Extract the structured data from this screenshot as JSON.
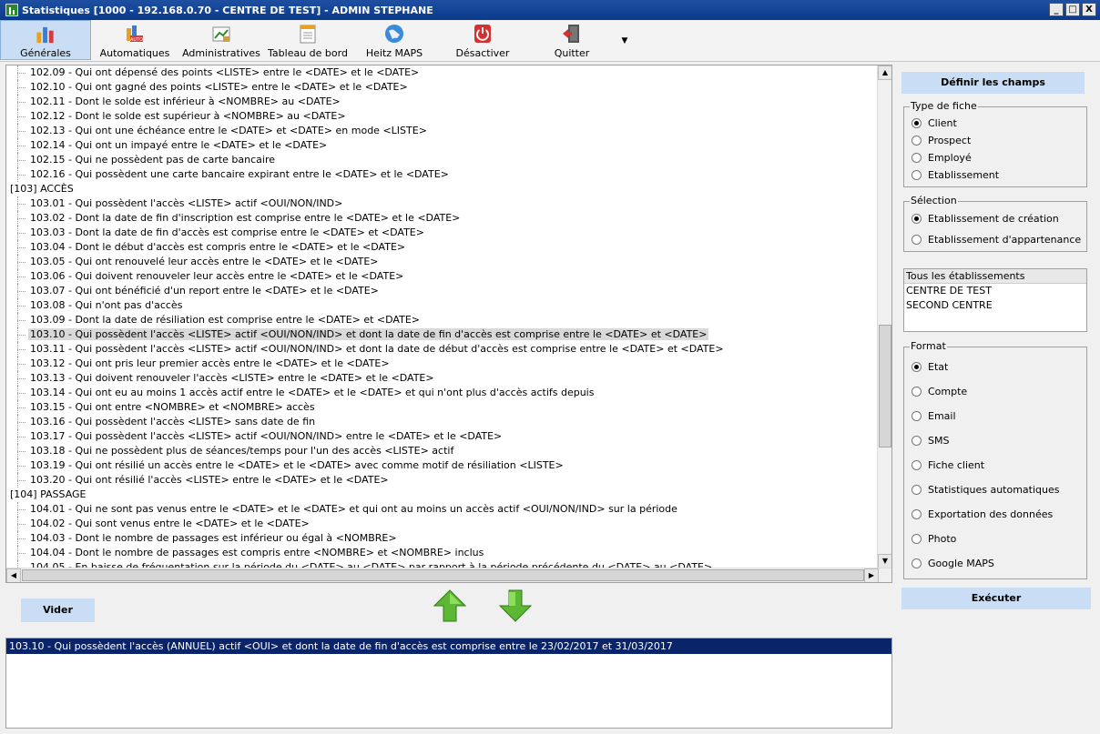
{
  "window": {
    "title": "Statistiques [1000 - 192.168.0.70 - CENTRE DE TEST] - ADMIN STEPHANE",
    "minimize": "_",
    "maximize": "□",
    "close": "X"
  },
  "toolbar": {
    "items": [
      {
        "label": "Générales",
        "icon": "general-stats-icon"
      },
      {
        "label": "Automatiques",
        "icon": "auto-icon"
      },
      {
        "label": "Administratives",
        "icon": "admin-icon"
      },
      {
        "label": "Tableau de bord",
        "icon": "dashboard-icon"
      },
      {
        "label": "Heitz MAPS",
        "icon": "globe-icon"
      },
      {
        "label": "Désactiver",
        "icon": "power-icon"
      },
      {
        "label": "Quitter",
        "icon": "exit-door-icon"
      }
    ],
    "more": "▼"
  },
  "list": {
    "lines": [
      {
        "type": "item",
        "text": "102.09 - Qui ont dépensé des points <LISTE> entre le <DATE> et le <DATE>"
      },
      {
        "type": "item",
        "text": "102.10 - Qui ont gagné des points <LISTE> entre le <DATE> et le <DATE>"
      },
      {
        "type": "item",
        "text": "102.11 - Dont le solde est inférieur à <NOMBRE> au <DATE>"
      },
      {
        "type": "item",
        "text": "102.12 - Dont le solde est supérieur à <NOMBRE> au <DATE>"
      },
      {
        "type": "item",
        "text": "102.13 - Qui ont une échéance entre le <DATE> et <DATE> en mode <LISTE>"
      },
      {
        "type": "item",
        "text": "102.14 - Qui ont un impayé entre le <DATE> et le <DATE>"
      },
      {
        "type": "item",
        "text": "102.15 - Qui ne possèdent pas de carte bancaire"
      },
      {
        "type": "item",
        "text": "102.16 - Qui possèdent une carte bancaire expirant entre le <DATE> et le <DATE>"
      },
      {
        "type": "group",
        "text": "[103] ACCÈS"
      },
      {
        "type": "item",
        "text": "103.01 - Qui possèdent l'accès <LISTE> actif <OUI/NON/IND>"
      },
      {
        "type": "item",
        "text": "103.02 - Dont la date de fin d'inscription est comprise entre le <DATE> et le <DATE>"
      },
      {
        "type": "item",
        "text": "103.03 - Dont la date de fin d'accès est comprise entre le <DATE> et <DATE>"
      },
      {
        "type": "item",
        "text": "103.04 - Dont le début d'accès est compris entre le <DATE> et le <DATE>"
      },
      {
        "type": "item",
        "text": "103.05 - Qui ont renouvelé leur accès entre le <DATE> et le <DATE>"
      },
      {
        "type": "item",
        "text": "103.06 - Qui doivent renouveler leur accès entre le <DATE> et le <DATE>"
      },
      {
        "type": "item",
        "text": "103.07 - Qui ont bénéficié d'un report entre le <DATE> et le <DATE>"
      },
      {
        "type": "item",
        "text": "103.08 - Qui n'ont pas d'accès"
      },
      {
        "type": "item",
        "text": "103.09 - Dont la date de résiliation est comprise entre le <DATE> et <DATE>"
      },
      {
        "type": "item",
        "text": "103.10 - Qui possèdent l'accès <LISTE> actif <OUI/NON/IND> et dont la date de fin d'accès est comprise entre le <DATE> et <DATE>",
        "selected": true
      },
      {
        "type": "item",
        "text": "103.11 - Qui possèdent l'accès <LISTE> actif <OUI/NON/IND> et dont la date de début d'accès est comprise entre le <DATE> et <DATE>"
      },
      {
        "type": "item",
        "text": "103.12 - Qui ont pris leur premier accès entre le <DATE> et le <DATE>"
      },
      {
        "type": "item",
        "text": "103.13 - Qui doivent renouveler l'accès <LISTE> entre le <DATE> et le <DATE>"
      },
      {
        "type": "item",
        "text": "103.14 - Qui ont eu au moins 1 accès actif entre le <DATE> et le <DATE> et qui n'ont plus d'accès actifs depuis"
      },
      {
        "type": "item",
        "text": "103.15 - Qui ont entre <NOMBRE> et <NOMBRE> accès"
      },
      {
        "type": "item",
        "text": "103.16 - Qui possèdent l'accès <LISTE> sans date de fin"
      },
      {
        "type": "item",
        "text": "103.17 - Qui possèdent l'accès <LISTE> actif <OUI/NON/IND> entre le <DATE> et le <DATE>"
      },
      {
        "type": "item",
        "text": "103.18 - Qui ne possèdent plus de séances/temps pour l'un des accès <LISTE> actif"
      },
      {
        "type": "item",
        "text": "103.19 - Qui ont résilié un accès entre le <DATE> et le <DATE> avec comme motif de résiliation <LISTE>"
      },
      {
        "type": "item",
        "text": "103.20 - Qui ont résilié l'accès <LISTE> entre le <DATE> et le <DATE>"
      },
      {
        "type": "group",
        "text": "[104] PASSAGE"
      },
      {
        "type": "item",
        "text": "104.01 - Qui ne sont pas venus entre le <DATE> et le <DATE> et qui ont au moins un accès actif <OUI/NON/IND> sur la période"
      },
      {
        "type": "item",
        "text": "104.02 - Qui sont venus entre le <DATE> et le <DATE>"
      },
      {
        "type": "item",
        "text": "104.03 - Dont le nombre de passages est inférieur ou égal à <NOMBRE>"
      },
      {
        "type": "item",
        "text": "104.04 - Dont le nombre de passages est compris entre <NOMBRE> et <NOMBRE> inclus"
      },
      {
        "type": "item",
        "text": "104.05 - En baisse de fréquentation sur la période du <DATE> au <DATE> par rapport à la période précédente du <DATE> au <DATE>"
      }
    ]
  },
  "actions": {
    "clear_label": "Vider",
    "up_icon": "arrow-up-icon",
    "down_icon": "arrow-down-icon"
  },
  "result": {
    "rows": [
      "103.10 - Qui possèdent l'accès (ANNUEL) actif <OUI> et dont la date de fin d'accès est comprise entre le 23/02/2017 et 31/03/2017"
    ]
  },
  "right": {
    "define_fields_label": "Définir les champs",
    "fiche_type": {
      "legend": "Type de fiche",
      "options": [
        "Client",
        "Prospect",
        "Employé",
        "Etablissement"
      ],
      "selected": 0
    },
    "selection": {
      "legend": "Sélection",
      "options": [
        "Etablissement de création",
        "Etablissement d'appartenance"
      ],
      "selected": 0
    },
    "establishments": {
      "header": "Tous les établissements",
      "items": [
        "CENTRE DE TEST",
        "SECOND CENTRE"
      ]
    },
    "format": {
      "legend": "Format",
      "options": [
        "Etat",
        "Compte",
        "Email",
        "SMS",
        "Fiche client",
        "Statistiques automatiques",
        "Exportation des données",
        "Photo",
        "Google MAPS"
      ],
      "selected": 0
    },
    "execute_label": "Exécuter"
  },
  "colors": {
    "accent": "#c9def5",
    "selection": "#0a246a",
    "arrow_green": "#4caf2c"
  }
}
